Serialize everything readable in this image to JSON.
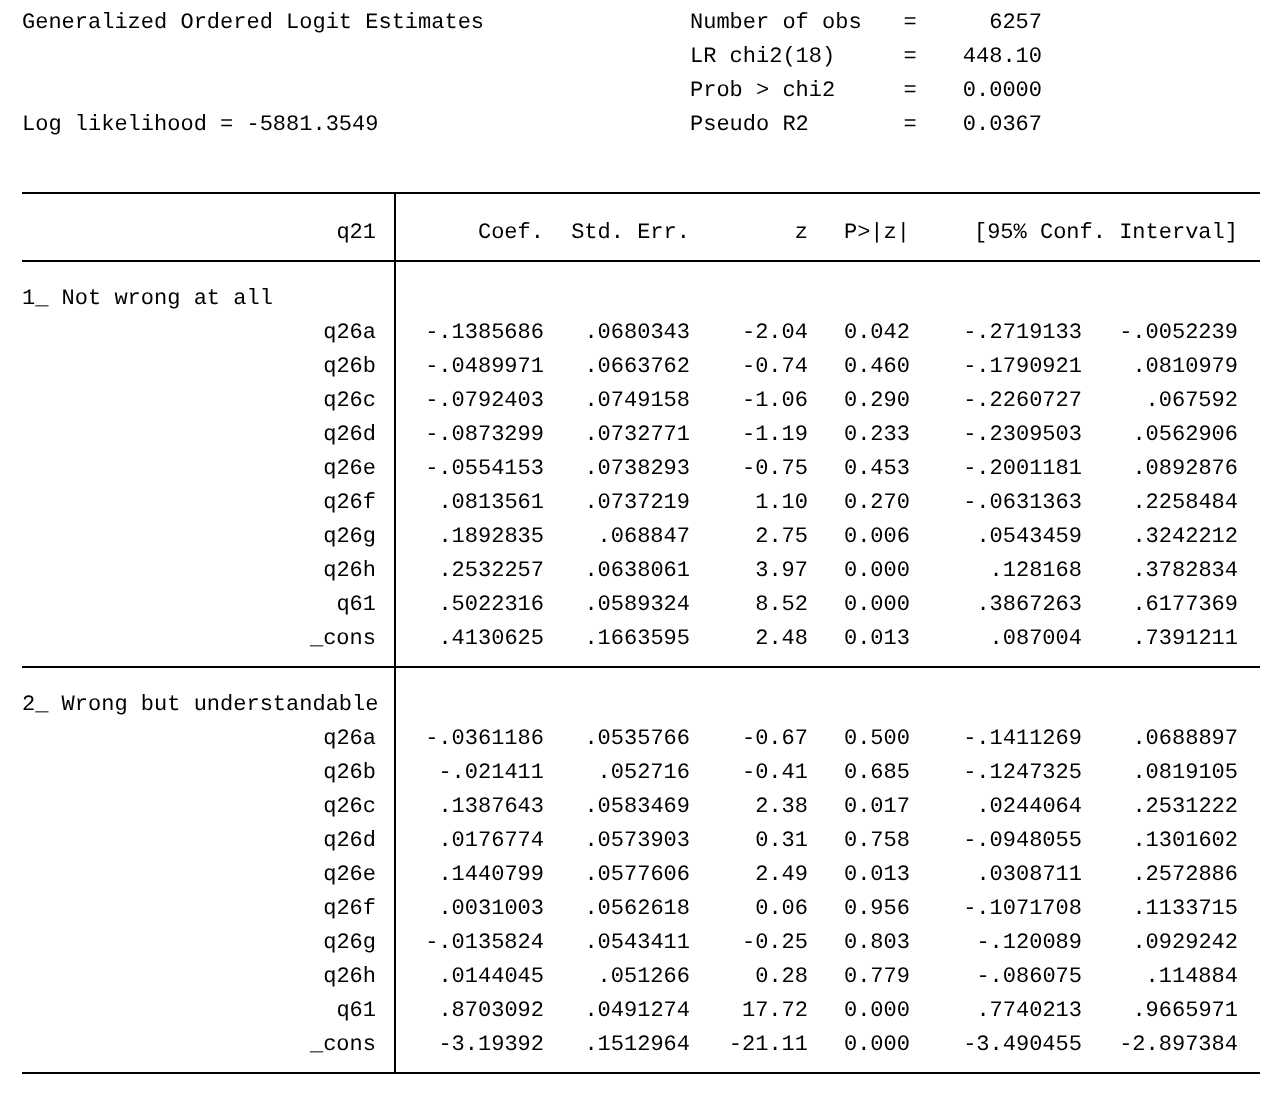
{
  "title": "Generalized Ordered Logit Estimates",
  "log_likelihood": "Log likelihood = -5881.3549",
  "stats": [
    {
      "label": "Number of obs",
      "equals": "=",
      "value": "6257"
    },
    {
      "label": "LR chi2(18)",
      "equals": "=",
      "value": "448.10"
    },
    {
      "label": "Prob > chi2",
      "equals": "=",
      "value": "0.0000"
    },
    {
      "label": "Pseudo R2",
      "equals": "=",
      "value": "0.0367"
    }
  ],
  "table": {
    "columns": [
      "q21",
      "Coef.",
      "Std. Err.",
      "z",
      "P>|z|",
      "[95% Conf. Interval]"
    ],
    "groups": [
      {
        "label": "1_ Not wrong at all",
        "rows": [
          {
            "name": "q26a",
            "cells": [
              "-.1385686",
              ".0680343",
              "-2.04",
              "0.042",
              "-.2719133",
              "-.0052239"
            ]
          },
          {
            "name": "q26b",
            "cells": [
              "-.0489971",
              ".0663762",
              "-0.74",
              "0.460",
              "-.1790921",
              ".0810979"
            ]
          },
          {
            "name": "q26c",
            "cells": [
              "-.0792403",
              ".0749158",
              "-1.06",
              "0.290",
              "-.2260727",
              ".067592"
            ]
          },
          {
            "name": "q26d",
            "cells": [
              "-.0873299",
              ".0732771",
              "-1.19",
              "0.233",
              "-.2309503",
              ".0562906"
            ]
          },
          {
            "name": "q26e",
            "cells": [
              "-.0554153",
              ".0738293",
              "-0.75",
              "0.453",
              "-.2001181",
              ".0892876"
            ]
          },
          {
            "name": "q26f",
            "cells": [
              ".0813561",
              ".0737219",
              "1.10",
              "0.270",
              "-.0631363",
              ".2258484"
            ]
          },
          {
            "name": "q26g",
            "cells": [
              ".1892835",
              ".068847",
              "2.75",
              "0.006",
              ".0543459",
              ".3242212"
            ]
          },
          {
            "name": "q26h",
            "cells": [
              ".2532257",
              ".0638061",
              "3.97",
              "0.000",
              ".128168",
              ".3782834"
            ]
          },
          {
            "name": "q61",
            "cells": [
              ".5022316",
              ".0589324",
              "8.52",
              "0.000",
              ".3867263",
              ".6177369"
            ]
          },
          {
            "name": "_cons",
            "cells": [
              ".4130625",
              ".1663595",
              "2.48",
              "0.013",
              ".087004",
              ".7391211"
            ]
          }
        ]
      },
      {
        "label": "2_ Wrong but understandable",
        "rows": [
          {
            "name": "q26a",
            "cells": [
              "-.0361186",
              ".0535766",
              "-0.67",
              "0.500",
              "-.1411269",
              ".0688897"
            ]
          },
          {
            "name": "q26b",
            "cells": [
              "-.021411",
              ".052716",
              "-0.41",
              "0.685",
              "-.1247325",
              ".0819105"
            ]
          },
          {
            "name": "q26c",
            "cells": [
              ".1387643",
              ".0583469",
              "2.38",
              "0.017",
              ".0244064",
              ".2531222"
            ]
          },
          {
            "name": "q26d",
            "cells": [
              ".0176774",
              ".0573903",
              "0.31",
              "0.758",
              "-.0948055",
              ".1301602"
            ]
          },
          {
            "name": "q26e",
            "cells": [
              ".1440799",
              ".0577606",
              "2.49",
              "0.013",
              ".0308711",
              ".2572886"
            ]
          },
          {
            "name": "q26f",
            "cells": [
              ".0031003",
              ".0562618",
              "0.06",
              "0.956",
              "-.1071708",
              ".1133715"
            ]
          },
          {
            "name": "q26g",
            "cells": [
              "-.0135824",
              ".0543411",
              "-0.25",
              "0.803",
              "-.120089",
              ".0929242"
            ]
          },
          {
            "name": "q26h",
            "cells": [
              ".0144045",
              ".051266",
              "0.28",
              "0.779",
              "-.086075",
              ".114884"
            ]
          },
          {
            "name": "q61",
            "cells": [
              ".8703092",
              ".0491274",
              "17.72",
              "0.000",
              ".7740213",
              ".9665971"
            ]
          },
          {
            "name": "_cons",
            "cells": [
              "-3.19392",
              ".1512964",
              "-21.11",
              "0.000",
              "-3.490455",
              "-2.897384"
            ]
          }
        ]
      }
    ]
  }
}
